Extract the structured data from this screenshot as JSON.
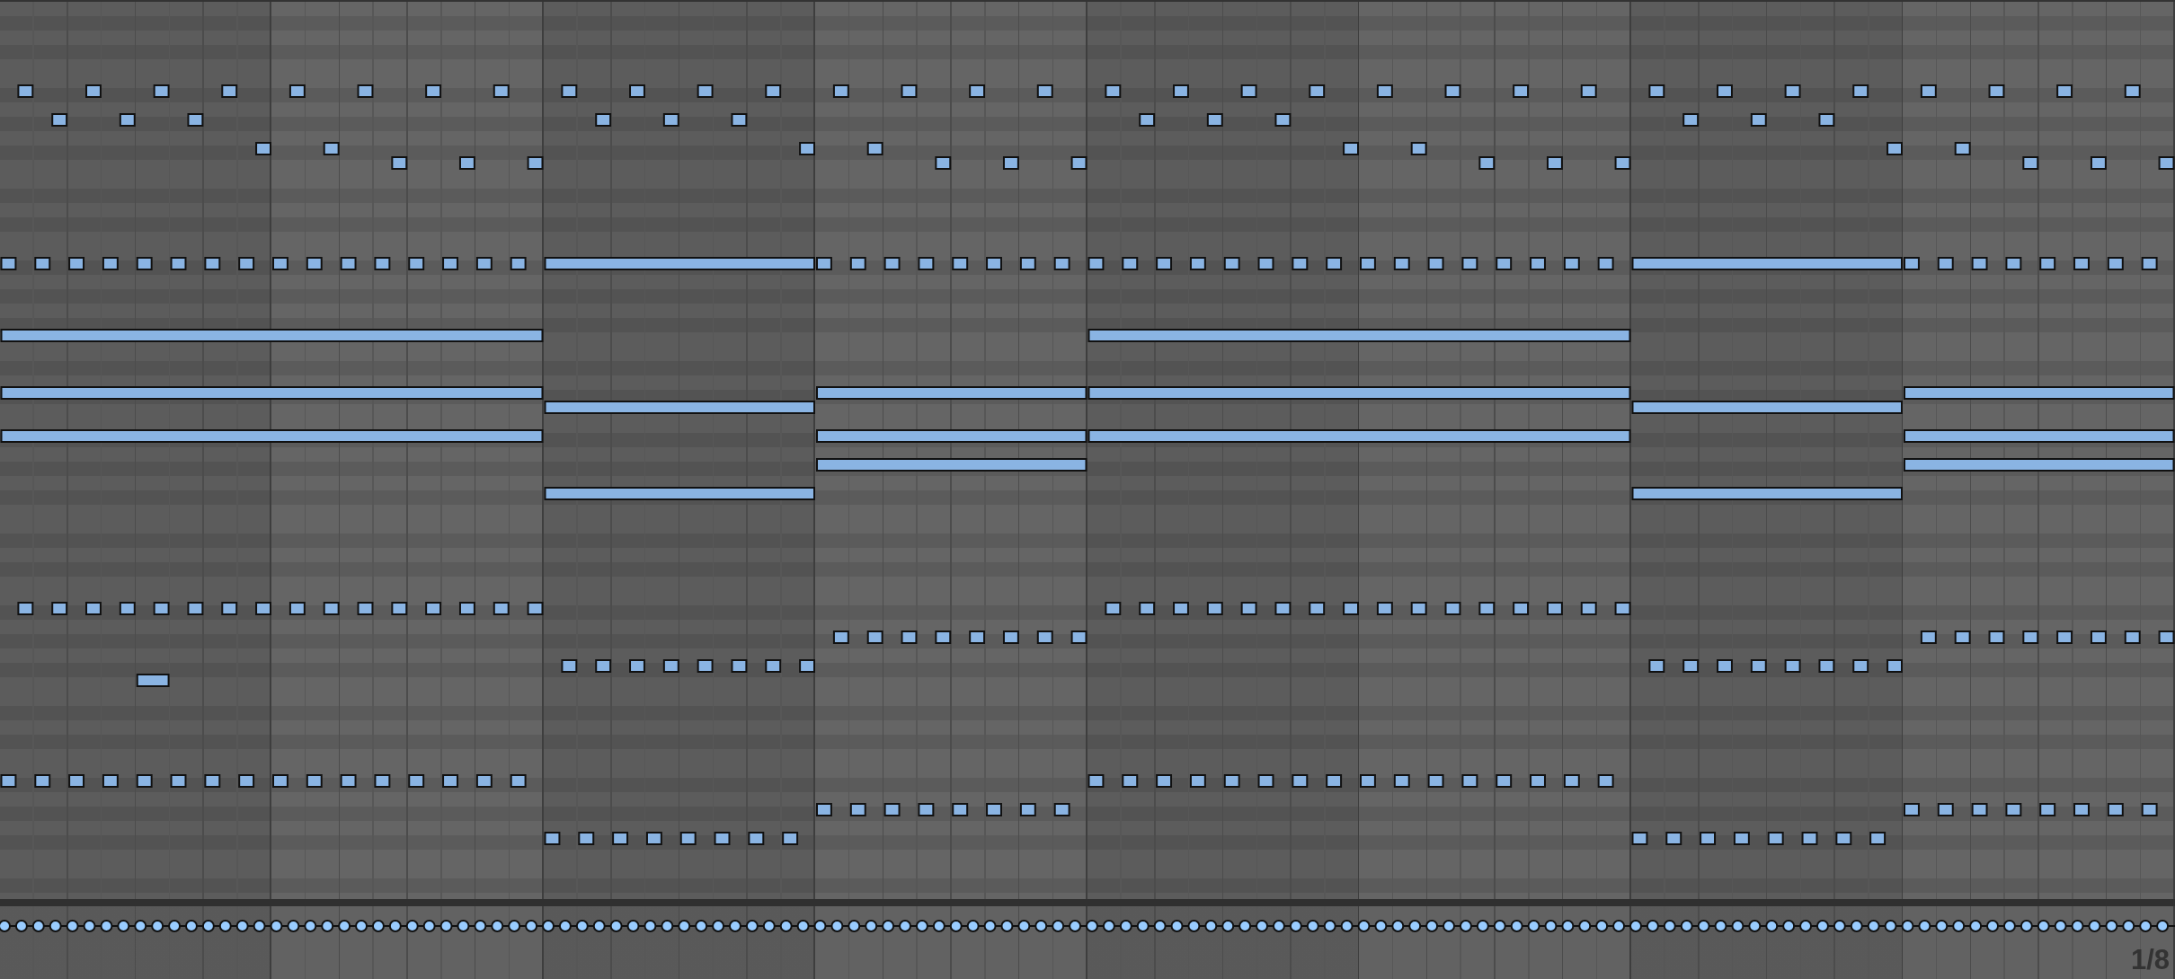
{
  "grid_label": "1/8"
}
